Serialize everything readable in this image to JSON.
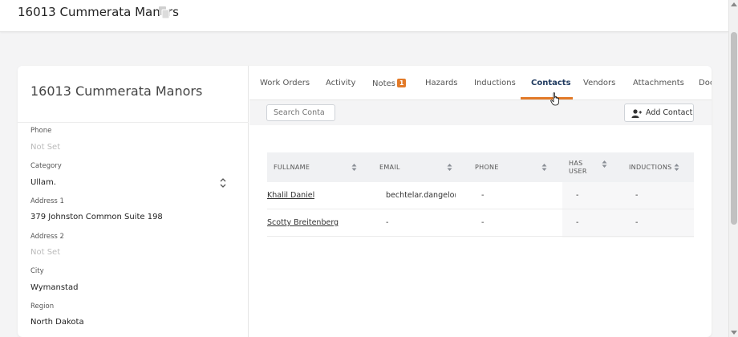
{
  "header": {
    "title": "16013 Cummerata Manors"
  },
  "property": {
    "title": "16013 Cummerata Manors",
    "fields": [
      {
        "label": "Phone",
        "value": "Not Set",
        "empty": true
      },
      {
        "label": "Category",
        "value": "Ullam.",
        "empty": false
      },
      {
        "label": "Address 1",
        "value": "379 Johnston Common Suite 198",
        "empty": false
      },
      {
        "label": "Address 2",
        "value": "Not Set",
        "empty": true
      },
      {
        "label": "City",
        "value": "Wymanstad",
        "empty": false
      },
      {
        "label": "Region",
        "value": "North Dakota",
        "empty": false
      }
    ]
  },
  "tabs": [
    {
      "label": "Work Orders"
    },
    {
      "label": "Activity"
    },
    {
      "label": "Notes",
      "badge": "1"
    },
    {
      "label": "Hazards"
    },
    {
      "label": "Inductions"
    },
    {
      "label": "Contacts",
      "active": true
    },
    {
      "label": "Vendors"
    },
    {
      "label": "Attachments"
    },
    {
      "label": "Doc"
    }
  ],
  "toolbar": {
    "search_placeholder": "Search Conta",
    "add_label": "Add Contact"
  },
  "table": {
    "headers": [
      "FULLNAME",
      "EMAIL",
      "PHONE",
      "HAS USER",
      "INDUCTIONS"
    ],
    "rows": [
      {
        "fullname": "Khalil Daniel",
        "email": "bechtelar.dangelo@e",
        "phone": "-",
        "has_user": "-",
        "inductions": "-"
      },
      {
        "fullname": "Scotty Breitenberg",
        "email": "-",
        "phone": "-",
        "has_user": "-",
        "inductions": "-"
      }
    ]
  },
  "colors": {
    "accent": "#e27a28",
    "active_tab": "#1f3a5f"
  }
}
